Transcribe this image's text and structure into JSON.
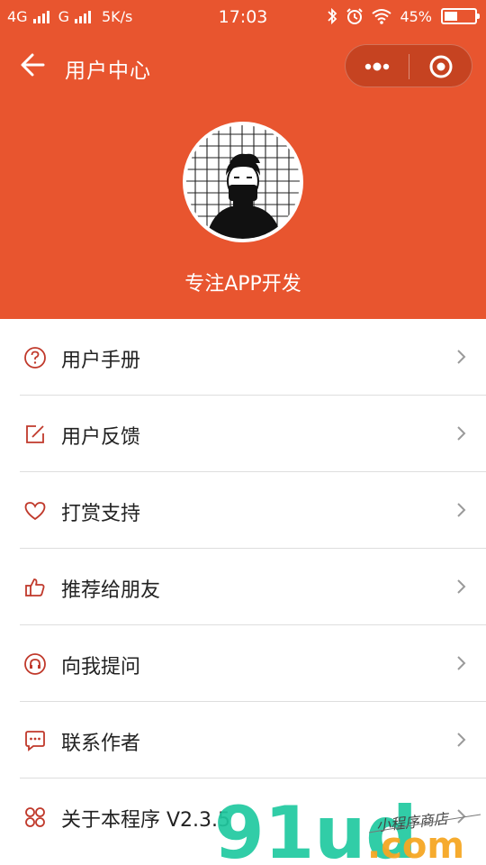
{
  "status_bar": {
    "network1": "4G",
    "network2": "G",
    "speed": "5K/s",
    "time": "17:03",
    "battery": "45%",
    "battery_level": 0.45
  },
  "nav": {
    "title": "用户中心"
  },
  "profile": {
    "tagline": "专注APP开发"
  },
  "menu": [
    {
      "label": "用户手册",
      "icon": "question-circle-icon"
    },
    {
      "label": "用户反馈",
      "icon": "edit-icon"
    },
    {
      "label": "打赏支持",
      "icon": "heart-icon"
    },
    {
      "label": "推荐给朋友",
      "icon": "thumbs-up-icon"
    },
    {
      "label": "向我提问",
      "icon": "headset-icon"
    },
    {
      "label": "联系作者",
      "icon": "chat-icon"
    },
    {
      "label": "关于本程序 V2.3.5",
      "icon": "grid-petals-icon"
    }
  ],
  "watermark": {
    "brand": "91ud",
    "domain": ".com",
    "tag": "小程序商店"
  },
  "colors": {
    "accent": "#e8552f",
    "icon": "#c0392b"
  }
}
